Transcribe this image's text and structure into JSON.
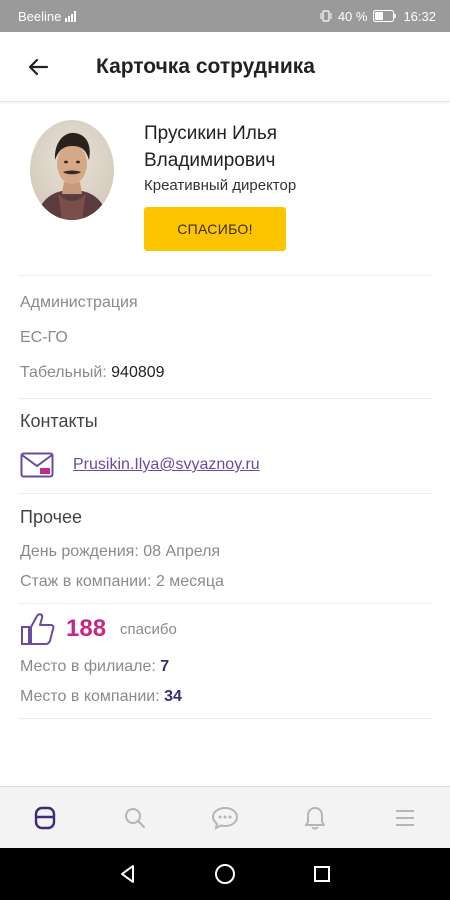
{
  "status_bar": {
    "carrier": "Beeline",
    "battery": "40 %",
    "time": "16:32"
  },
  "header": {
    "title": "Карточка сотрудника"
  },
  "profile": {
    "name": "Прусикин Илья Владимирович",
    "position": "Креативный директор",
    "thanks_button": "СПАСИБО!"
  },
  "info": {
    "department": "Администрация",
    "unit": "ЕС-ГО",
    "tab_label": "Табельный:",
    "tab_number": "940809"
  },
  "contacts": {
    "title": "Контакты",
    "email": "Prusikin.Ilya@svyaznoy.ru"
  },
  "other": {
    "title": "Прочее",
    "birthday": "День рождения: 08 Апреля",
    "tenure": "Стаж в компании: 2 месяца"
  },
  "thanks": {
    "count": "188",
    "label": "спасибо",
    "branch_label": "Место в филиале:",
    "branch_rank": "7",
    "company_label": "Место в компании:",
    "company_rank": "34"
  },
  "colors": {
    "accent_yellow": "#fdc500",
    "likes_pink": "#c4298a",
    "primary_purple": "#3d2b73",
    "link_purple": "#6a4aa3"
  },
  "icons": {
    "back": "arrow-left-icon",
    "email": "envelope-icon",
    "likes": "thumbs-up-icon",
    "nav": [
      "profile-icon",
      "search-icon",
      "chat-icon",
      "bell-icon",
      "menu-icon"
    ],
    "system": [
      "back-triangle-icon",
      "home-circle-icon",
      "recents-square-icon"
    ]
  }
}
